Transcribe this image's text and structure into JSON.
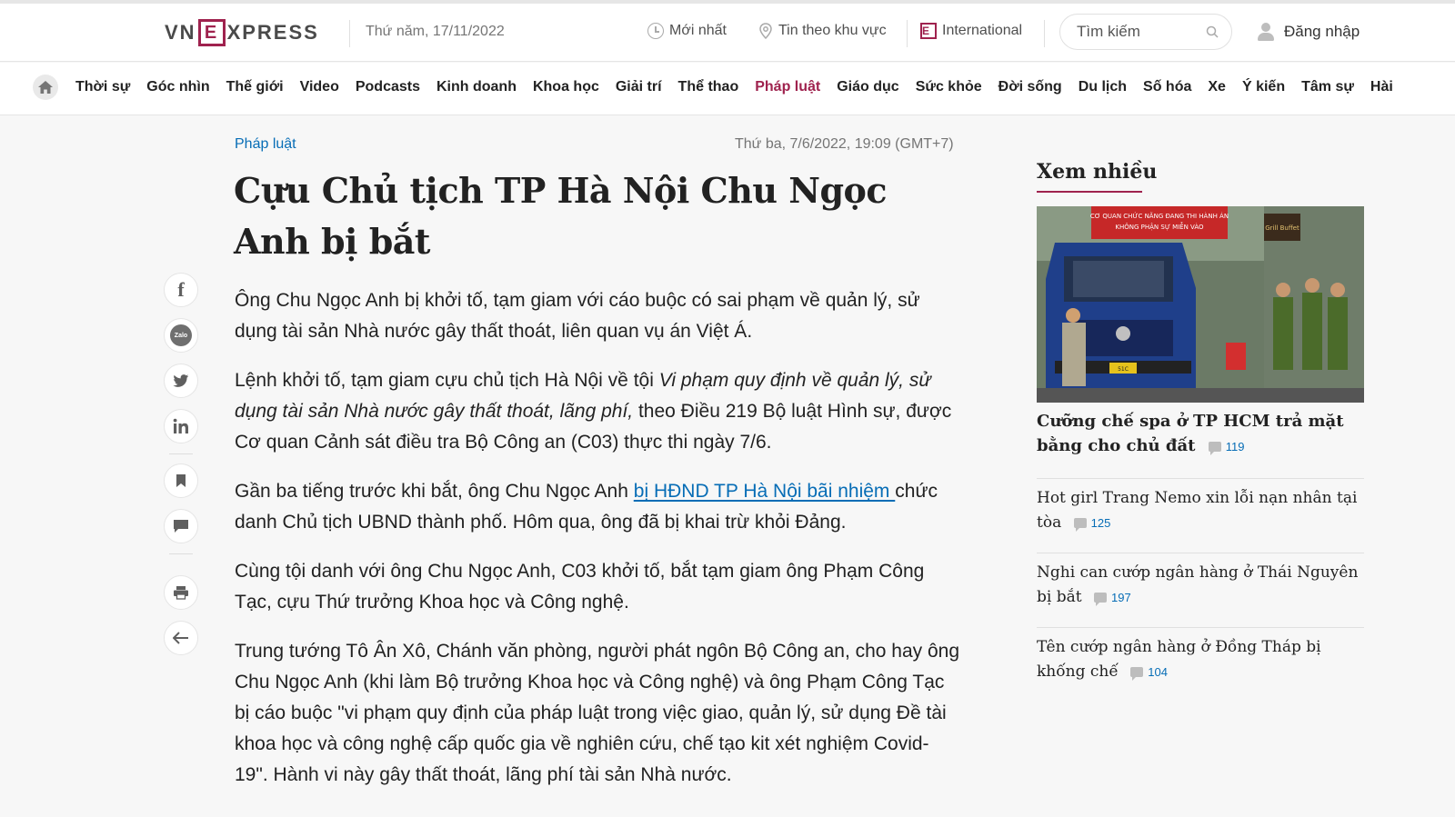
{
  "header": {
    "logo_left": "VN",
    "logo_box": "E",
    "logo_right": "XPRESS",
    "date": "Thứ năm, 17/11/2022",
    "latest": "Mới nhất",
    "regional": "Tin theo khu vực",
    "international": "International",
    "search_placeholder": "Tìm kiếm",
    "login": "Đăng nhập"
  },
  "nav": {
    "items": [
      "Thời sự",
      "Góc nhìn",
      "Thế giới",
      "Video",
      "Podcasts",
      "Kinh doanh",
      "Khoa học",
      "Giải trí",
      "Thể thao",
      "Pháp luật",
      "Giáo dục",
      "Sức khỏe",
      "Đời sống",
      "Du lịch",
      "Số hóa",
      "Xe",
      "Ý kiến",
      "Tâm sự",
      "Hài"
    ],
    "active_index": 9
  },
  "article": {
    "category": "Pháp luật",
    "date": "Thứ ba, 7/6/2022, 19:09 (GMT+7)",
    "title": "Cựu Chủ tịch TP Hà Nội Chu Ngọc Anh bị bắt",
    "lead": "Ông Chu Ngọc Anh bị khởi tố, tạm giam với cáo buộc có sai phạm về quản lý, sử dụng tài sản Nhà nước gây thất thoát, liên quan vụ án Việt Á.",
    "p1_a": "Lệnh khởi tố, tạm giam cựu chủ tịch Hà Nội về tội ",
    "p1_em": "Vi phạm quy định về quản lý, sử dụng tài sản Nhà nước gây thất thoát, lãng phí,",
    "p1_b": " theo Điều 219 Bộ luật Hình sự, được Cơ quan Cảnh sát điều tra Bộ Công an (C03) thực thi ngày 7/6.",
    "p2_a": "Gần ba tiếng trước khi bắt, ông Chu Ngọc Anh ",
    "p2_link": "bị HĐND TP Hà Nội bãi nhiệm ",
    "p2_b": "chức danh Chủ tịch UBND thành phố. Hôm qua, ông đã bị khai trừ khỏi Đảng.",
    "p3": "Cùng tội danh với ông Chu Ngọc Anh, C03 khởi tố, bắt tạm giam ông Phạm Công Tạc, cựu Thứ trưởng Khoa học và Công nghệ.",
    "p4": "Trung tướng Tô Ân Xô, Chánh văn phòng, người phát ngôn Bộ Công an, cho hay ông Chu Ngọc Anh (khi làm Bộ trưởng Khoa học và Công nghệ) và ông Phạm Công Tạc bị cáo buộc \"vi phạm quy định của pháp luật trong việc giao, quản lý, sử dụng Đề tài khoa học và công nghệ cấp quốc gia về nghiên cứu, chế tạo kit xét nghiệm Covid-19\". Hành vi này gây thất thoát, lãng phí tài sản Nhà nước."
  },
  "share": {
    "facebook": "f",
    "zalo": "Zalo"
  },
  "most_read": {
    "title": "Xem nhiều",
    "image_banner": "CƠ QUAN CHỨC NĂNG ĐANG THI HÀNH ÁN · KHÔNG PHẬN SỰ MIỄN VÀO",
    "image_sign": "Grill Buffet",
    "image_plate": "51C",
    "items": [
      {
        "title": "Cưỡng chế spa ở TP HCM trả mặt bằng cho chủ đất",
        "comments": "119"
      },
      {
        "title": "Hot girl Trang Nemo xin lỗi nạn nhân tại tòa",
        "comments": "125"
      },
      {
        "title": "Nghi can cướp ngân hàng ở Thái Nguyên bị bắt",
        "comments": "197"
      },
      {
        "title": "Tên cướp ngân hàng ở Đồng Tháp bị khống chế",
        "comments": "104"
      }
    ]
  },
  "colors": {
    "brand": "#9f224e",
    "link": "#076db6"
  }
}
